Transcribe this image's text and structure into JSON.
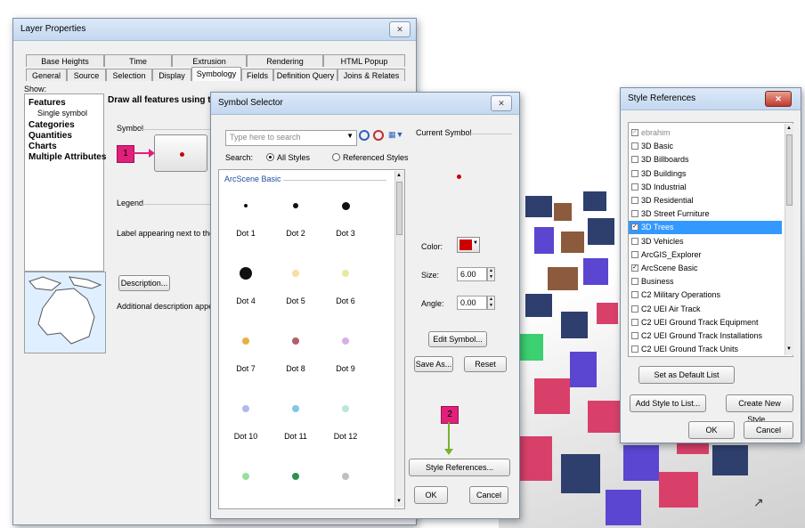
{
  "layer_properties": {
    "title": "Layer Properties",
    "close_glyph": "✕",
    "tabs_top": [
      "Base Heights",
      "Time",
      "Extrusion",
      "Rendering",
      "HTML Popup"
    ],
    "tabs_bottom": [
      "General",
      "Source",
      "Selection",
      "Display",
      "Symbology",
      "Fields",
      "Definition Query",
      "Joins & Relates"
    ],
    "active_tab": "Symbology",
    "show_label": "Show:",
    "show_items": [
      "Features",
      "Single symbol",
      "Categories",
      "Quantities",
      "Charts",
      "Multiple Attributes"
    ],
    "draw_text": "Draw all features using the sam",
    "symbol_group": "Symbol",
    "legend_group": "Legend",
    "legend_label": "Label appearing next to the symbo",
    "description_btn": "Description...",
    "additional_desc": "Additional description appearing n",
    "callout_1": "1"
  },
  "symbol_selector": {
    "title": "Symbol Selector",
    "close_glyph": "✕",
    "search_placeholder": "Type here to search",
    "search_label": "Search:",
    "radio_all": "All Styles",
    "radio_referenced": "Referenced Styles",
    "group_title": "ArcScene Basic",
    "symbols": [
      {
        "label": "Dot 1",
        "color": "#111111",
        "size": 4
      },
      {
        "label": "Dot 2",
        "color": "#111111",
        "size": 6
      },
      {
        "label": "Dot 3",
        "color": "#111111",
        "size": 9
      },
      {
        "label": "Dot 4",
        "color": "#111111",
        "size": 14
      },
      {
        "label": "Dot 5",
        "color": "#f7dfa0",
        "size": 8
      },
      {
        "label": "Dot 6",
        "color": "#e8e8a0",
        "size": 8
      },
      {
        "label": "Dot 7",
        "color": "#e8b040",
        "size": 8
      },
      {
        "label": "Dot 8",
        "color": "#b06068",
        "size": 8
      },
      {
        "label": "Dot 9",
        "color": "#d8b0e8",
        "size": 8
      },
      {
        "label": "Dot 10",
        "color": "#b0b8f0",
        "size": 8
      },
      {
        "label": "Dot 11",
        "color": "#80c8e8",
        "size": 8
      },
      {
        "label": "Dot 12",
        "color": "#b8e8d8",
        "size": 8
      },
      {
        "label": "",
        "color": "#98e0a0",
        "size": 8
      },
      {
        "label": "",
        "color": "#309050",
        "size": 8
      },
      {
        "label": "",
        "color": "#c0c0c0",
        "size": 8
      }
    ],
    "current_symbol_label": "Current Symbol",
    "color_label": "Color:",
    "color_value": "#cc0000",
    "size_label": "Size:",
    "size_value": "6.00",
    "angle_label": "Angle:",
    "angle_value": "0.00",
    "edit_symbol_btn": "Edit Symbol...",
    "save_as_btn": "Save As...",
    "reset_btn": "Reset",
    "style_references_btn": "Style References...",
    "ok_btn": "OK",
    "cancel_btn": "Cancel",
    "callout_2": "2"
  },
  "style_references": {
    "title": "Style References",
    "close_glyph": "✕",
    "items": [
      {
        "label": "ebrahim",
        "checked": true,
        "disabled": true
      },
      {
        "label": "3D Basic",
        "checked": false
      },
      {
        "label": "3D Billboards",
        "checked": false
      },
      {
        "label": "3D Buildings",
        "checked": false
      },
      {
        "label": "3D Industrial",
        "checked": false
      },
      {
        "label": "3D Residential",
        "checked": false
      },
      {
        "label": "3D Street Furniture",
        "checked": false
      },
      {
        "label": "3D Trees",
        "checked": true,
        "selected": true
      },
      {
        "label": "3D Vehicles",
        "checked": false
      },
      {
        "label": "ArcGIS_Explorer",
        "checked": false
      },
      {
        "label": "ArcScene Basic",
        "checked": true
      },
      {
        "label": "Business",
        "checked": false
      },
      {
        "label": "C2 Military Operations",
        "checked": false
      },
      {
        "label": "C2 UEI Air Track",
        "checked": false
      },
      {
        "label": "C2 UEI Ground Track Equipment",
        "checked": false
      },
      {
        "label": "C2 UEI Ground Track Installations",
        "checked": false
      },
      {
        "label": "C2 UEI Ground Track Units",
        "checked": false
      }
    ],
    "set_default_btn": "Set as Default List",
    "add_style_btn": "Add Style to List...",
    "create_style_btn": "Create New Style...",
    "ok_btn": "OK",
    "cancel_btn": "Cancel"
  },
  "colors": {
    "callout": "#e0207a",
    "selection": "#3399ff",
    "arrow_green": "#7ab030"
  }
}
